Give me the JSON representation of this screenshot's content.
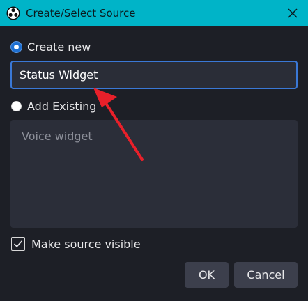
{
  "window": {
    "title": "Create/Select Source",
    "app_icon": "obs-logo-icon",
    "close_icon": "close-icon"
  },
  "create_new": {
    "label": "Create new",
    "selected": true
  },
  "source_name_input": {
    "value": "Status Widget"
  },
  "add_existing": {
    "label": "Add Existing",
    "selected": false
  },
  "existing_sources": {
    "items": [
      "Voice widget"
    ]
  },
  "make_visible": {
    "label": "Make source visible",
    "checked": true
  },
  "buttons": {
    "ok": "OK",
    "cancel": "Cancel"
  },
  "colors": {
    "titlebar": "#00b4c8",
    "background": "#1d1f26",
    "accent": "#3a78d6",
    "annotation_arrow": "#e8202a"
  }
}
